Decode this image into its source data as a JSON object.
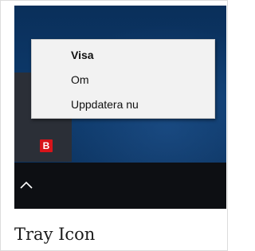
{
  "context_menu": {
    "items": [
      {
        "label": "Visa",
        "bold": true
      },
      {
        "label": "Om",
        "bold": false
      },
      {
        "label": "Uppdatera nu",
        "bold": false
      }
    ]
  },
  "tray": {
    "app_icon": {
      "name": "avira-tray-icon",
      "glyph": "B",
      "color": "#d7141a"
    },
    "overflow_icon": "chevron-up-icon"
  },
  "caption": "Tray Icon"
}
